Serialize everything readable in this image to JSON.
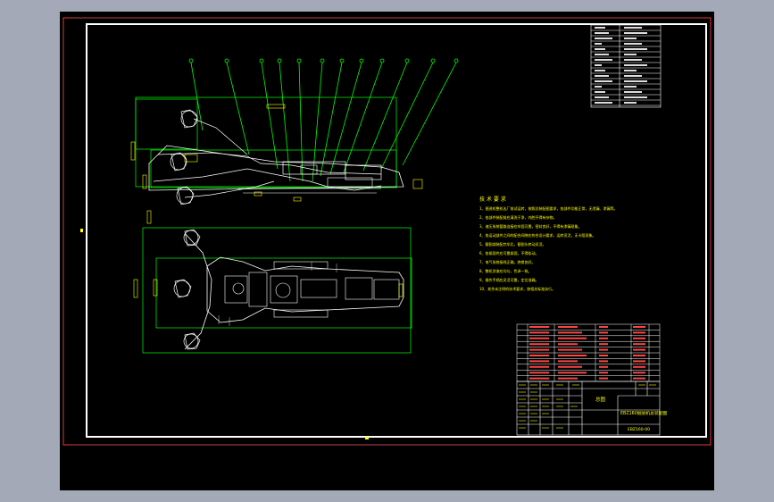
{
  "drawing": {
    "tech_requirements_title": "技 术 要 求",
    "tech_requirements": [
      "1、掘进机整机出厂前试运转，按照总装配图要求，各部件功能正常，无泄漏、渗漏等。",
      "2、各部件装配前应清洗干净，内腔不得有杂物。",
      "3、液压系统管路连接应牢固可靠，密封良好，不得有渗漏现象。",
      "4、各运动部件之间的配合间隙应符合设计要求，运转灵活，无卡阻现象。",
      "5、截割部装配完毕后，截割头转动灵活。",
      "6、各紧固件应可靠紧固，不得松动。",
      "7、电气系统接线正确，绝缘良好。",
      "8、整机涂漆应均匀，色泽一致。",
      "9、操作手柄应灵活可靠，定位准确。",
      "10、其余未注明的技术要求，按相关标准执行。"
    ],
    "title_block_main": "总图",
    "title_block_product": "EBZ160掘进机总装配图",
    "title_block_code": "EBZ160-00"
  }
}
